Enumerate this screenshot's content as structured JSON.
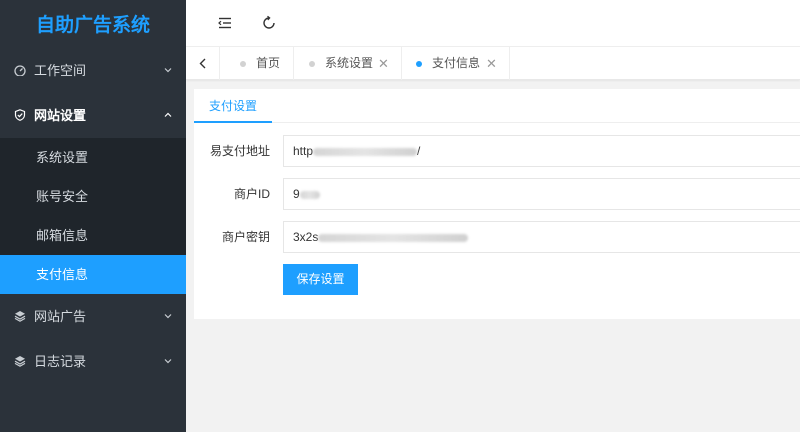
{
  "app": {
    "title": "自助广告系统"
  },
  "colors": {
    "accent": "#1e9fff",
    "sidebar_bg": "#2b323a",
    "submenu_bg": "#1f252b"
  },
  "sidebar": {
    "items": [
      {
        "label": "工作空间",
        "icon": "dashboard-icon",
        "expanded": false
      },
      {
        "label": "网站设置",
        "icon": "shield-check-icon",
        "expanded": true,
        "children": [
          {
            "label": "系统设置"
          },
          {
            "label": "账号安全"
          },
          {
            "label": "邮箱信息"
          },
          {
            "label": "支付信息",
            "selected": true
          }
        ]
      },
      {
        "label": "网站广告",
        "icon": "layers-icon",
        "expanded": false
      },
      {
        "label": "日志记录",
        "icon": "layers-icon",
        "expanded": false
      }
    ]
  },
  "header": {
    "menu_toggle": "menu-fold-icon",
    "refresh": "refresh-icon"
  },
  "tabs": [
    {
      "label": "首页",
      "closable": false,
      "active": false
    },
    {
      "label": "系统设置",
      "closable": true,
      "active": false
    },
    {
      "label": "支付信息",
      "closable": true,
      "active": true
    }
  ],
  "panel": {
    "tab_label": "支付设置",
    "fields": [
      {
        "label": "易支付地址",
        "value_prefix": "http",
        "value_suffix": "/"
      },
      {
        "label": "商户ID",
        "value_prefix": "9",
        "value_suffix": ""
      },
      {
        "label": "商户密钥",
        "value_prefix": "3x2s",
        "value_suffix": ""
      }
    ],
    "save_label": "保存设置"
  },
  "close_glyph": "✕"
}
